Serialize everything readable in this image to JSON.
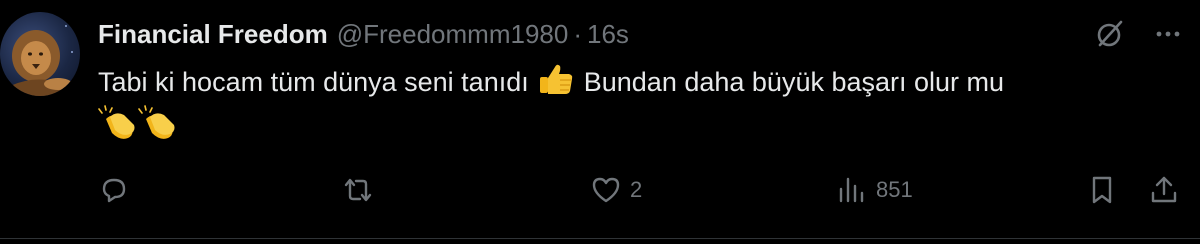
{
  "tweet": {
    "display_name": "Financial Freedom",
    "handle": "@Freedommm1980",
    "separator": "·",
    "time": "16s",
    "text_part1": "Tabi ki hocam tüm dünya seni tanıdı ",
    "text_part2": " Bundan daha büyük başarı olur mu",
    "emojis": [
      "thumbs-up",
      "clapping-hands",
      "clapping-hands"
    ]
  },
  "metrics": {
    "reply_count": "",
    "retweet_count": "",
    "like_count": "2",
    "view_count": "851"
  },
  "icons": {
    "grok": "grok-icon",
    "more": "more-icon",
    "reply": "reply-icon",
    "retweet": "retweet-icon",
    "like": "heart-icon",
    "views": "views-icon",
    "bookmark": "bookmark-icon",
    "share": "share-icon"
  },
  "colors": {
    "background": "#000000",
    "text_primary": "#e7e9ea",
    "text_secondary": "#71767b",
    "divider": "#2f3336"
  }
}
